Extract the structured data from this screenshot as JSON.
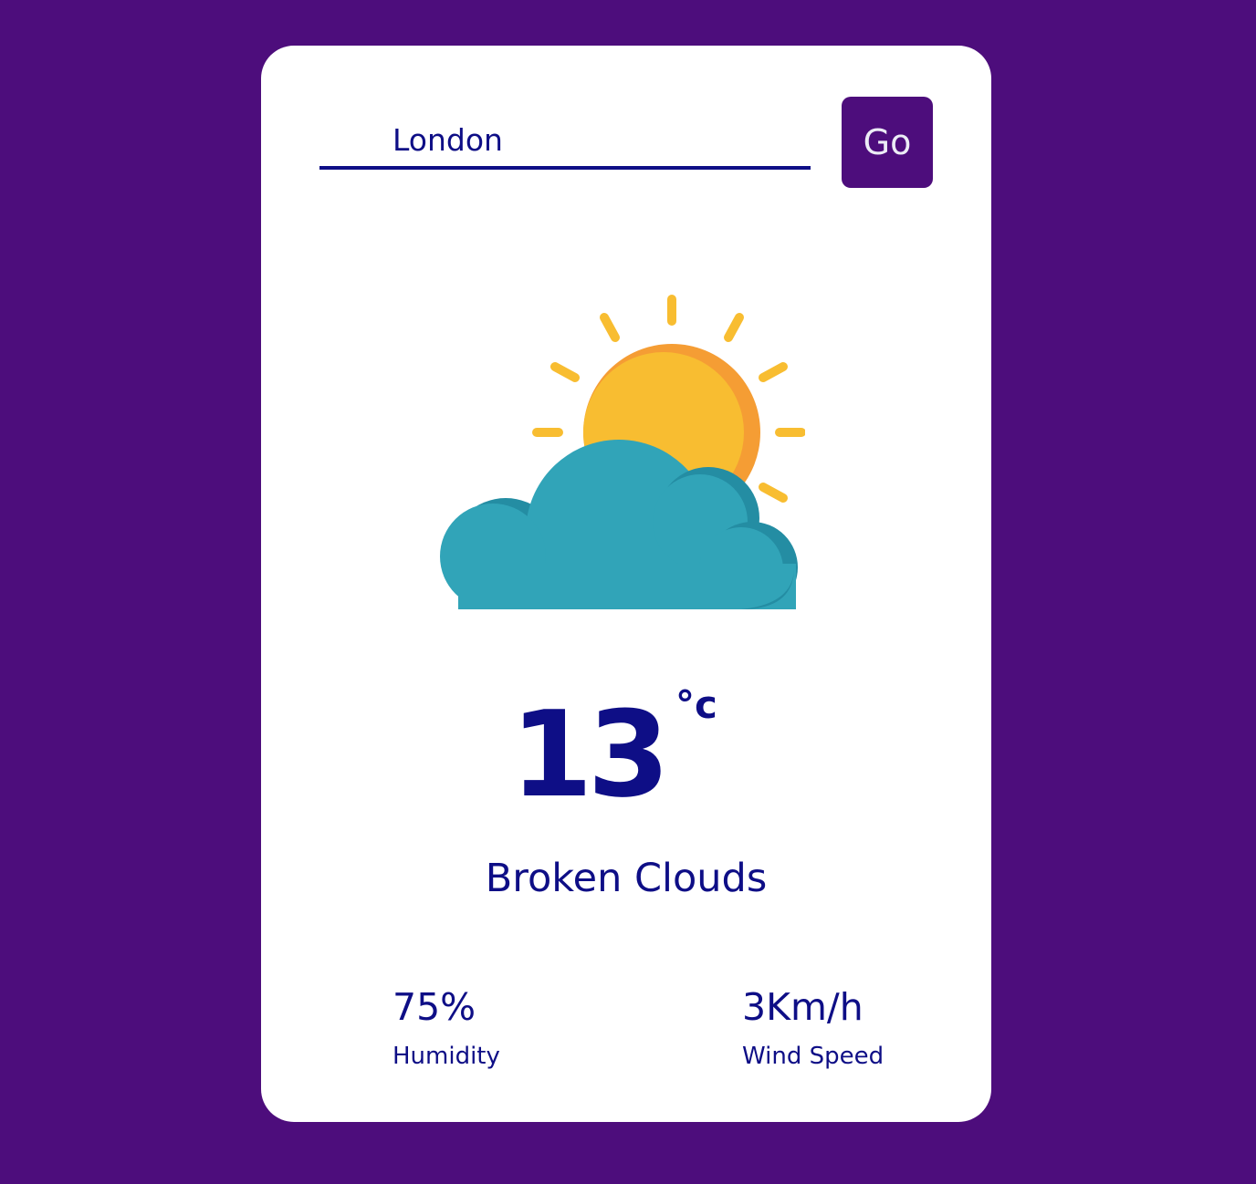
{
  "search": {
    "value": "London",
    "button_label": "Go"
  },
  "weather": {
    "icon": "sun-behind-cloud-icon",
    "temperature": "13",
    "unit": "°c",
    "condition": "Broken Clouds"
  },
  "stats": {
    "humidity": {
      "value": "75%",
      "label": "Humidity"
    },
    "wind": {
      "value": "3Km/h",
      "label": "Wind Speed"
    }
  },
  "colors": {
    "background": "#4d0d7c",
    "card": "#ffffff",
    "text": "#0e0e86",
    "button": "#4d0d7c",
    "sun": "#f8bd31",
    "sun_shade": "#f59d34",
    "cloud": "#31a4b8",
    "cloud_shade": "#248da3"
  }
}
